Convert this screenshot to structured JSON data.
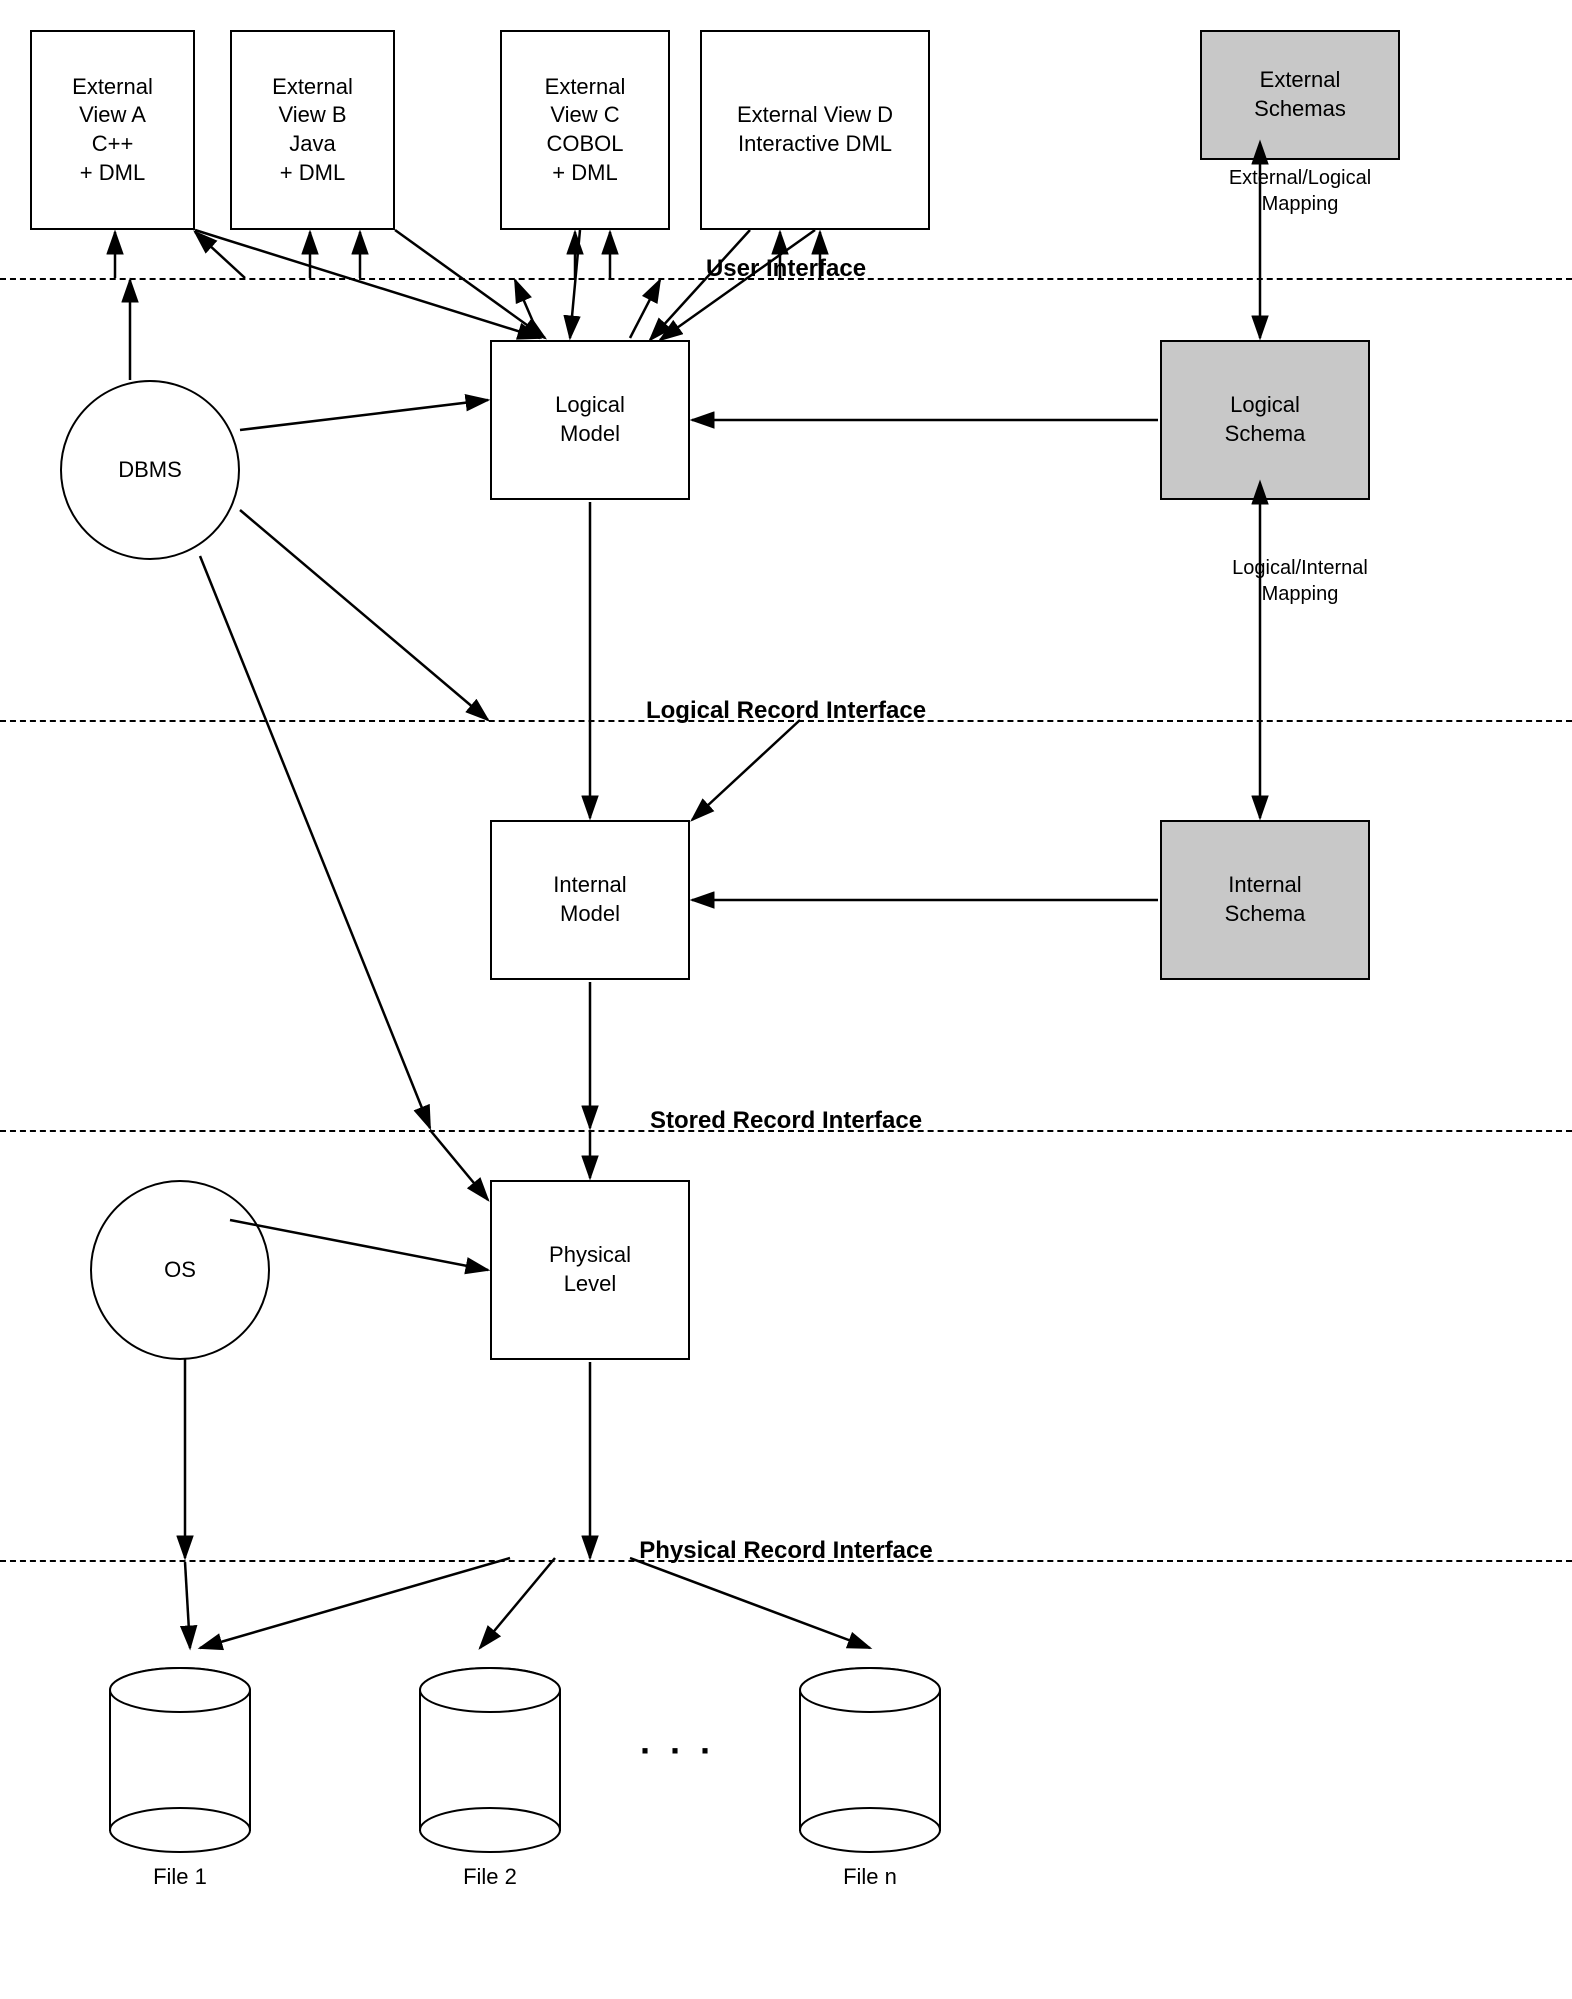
{
  "boxes": {
    "extViewA": {
      "label": "External\nView A\nC++\n+ DML"
    },
    "extViewB": {
      "label": "External\nView B\nJava\n+ DML"
    },
    "extViewC": {
      "label": "External\nView C\nCOBOL\n+ DML"
    },
    "extViewD": {
      "label": "External View D\nInteractive DML"
    },
    "extSchemas": {
      "label": "External\nSchemas"
    },
    "logicalModel": {
      "label": "Logical\nModel"
    },
    "logicalSchema": {
      "label": "Logical\nSchema"
    },
    "internalModel": {
      "label": "Internal\nModel"
    },
    "internalSchema": {
      "label": "Internal\nSchema"
    },
    "physicalLevel": {
      "label": "Physical\nLevel"
    }
  },
  "circles": {
    "dbms": {
      "label": "DBMS"
    },
    "os": {
      "label": "OS"
    }
  },
  "interfaces": {
    "userInterface": {
      "label": "User Interface"
    },
    "logicalRecordInterface": {
      "label": "Logical Record Interface"
    },
    "storedRecordInterface": {
      "label": "Stored Record Interface"
    },
    "physicalRecordInterface": {
      "label": "Physical Record Interface"
    }
  },
  "mappings": {
    "externalLogical": {
      "label": "External/Logical\nMapping"
    },
    "logicalInternal": {
      "label": "Logical/Internal\nMapping"
    }
  },
  "files": {
    "file1": {
      "label": "File 1"
    },
    "file2": {
      "label": "File 2"
    },
    "fileN": {
      "label": "File n"
    }
  },
  "dots": {
    "label": "· · ·"
  }
}
